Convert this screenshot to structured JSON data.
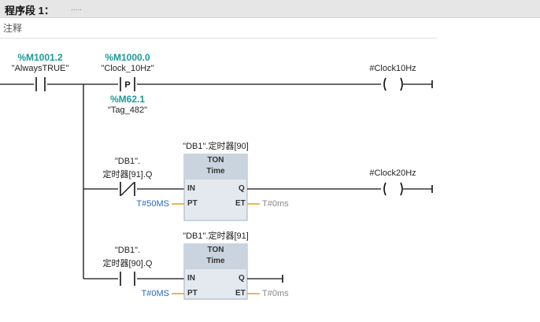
{
  "header": {
    "title": "程序段 1：",
    "dots": "....."
  },
  "comment": "注释",
  "contact1": {
    "address": "%M1001.2",
    "tag": "\"AlwaysTRUE\""
  },
  "contact2": {
    "address": "%M1000.0",
    "tag": "\"Clock_10Hz\"",
    "type_label": "P",
    "edge_address": "%M62.1",
    "edge_tag": "\"Tag_482\""
  },
  "coil1": {
    "tag": "#Clock10Hz"
  },
  "coil2": {
    "tag": "#Clock20Hz"
  },
  "timer1": {
    "instance": "\"DB1\".定时器[90]",
    "type": "TON",
    "subtype": "Time",
    "contact_tag_line1": "\"DB1\".",
    "contact_tag_line2": "定时器[91].Q",
    "pin_in": "IN",
    "pin_pt": "PT",
    "pin_q": "Q",
    "pin_et": "ET",
    "pt_value": "T#50MS",
    "et_value": "T#0ms"
  },
  "timer2": {
    "instance": "\"DB1\".定时器[91]",
    "type": "TON",
    "subtype": "Time",
    "contact_tag_line1": "\"DB1\".",
    "contact_tag_line2": "定时器[90].Q",
    "pin_in": "IN",
    "pin_pt": "PT",
    "pin_q": "Q",
    "pin_et": "ET",
    "pt_value": "T#0MS",
    "et_value": "T#0ms"
  },
  "colors": {
    "wire": "#111111",
    "address": "#1a9a9a",
    "box_fill": "#e3e9ef",
    "box_head": "#c9d4df",
    "param_line": "#f0a020",
    "pt_text": "#2a6ab8"
  }
}
